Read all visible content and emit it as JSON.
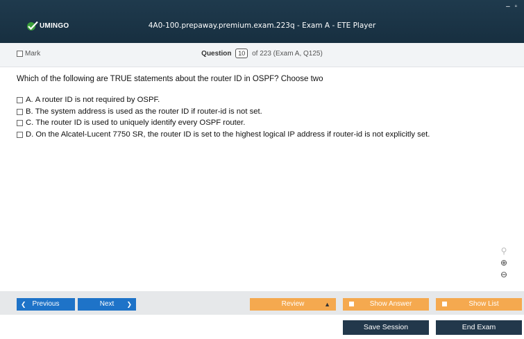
{
  "window": {
    "title": "4A0-100.prepaway.premium.exam.223q - Exam A - ETE Player",
    "controls": "– ▫",
    "logo_text": "UMINGO"
  },
  "question_bar": {
    "mark_label": "Mark",
    "question_label": "Question",
    "question_number": "10",
    "counter_rest": "of 223 (Exam A, Q125)"
  },
  "question": {
    "text": "Which of the following are TRUE statements about the router ID in OSPF? Choose two",
    "options": [
      {
        "letter": "A.",
        "text": "A router ID is not required by OSPF."
      },
      {
        "letter": "B.",
        "text": "The system address is used as the router ID if router-id is not set."
      },
      {
        "letter": "C.",
        "text": "The router ID is used to uniquely identify every OSPF router."
      },
      {
        "letter": "D.",
        "text": "On the Alcatel-Lucent 7750 SR, the router ID is set to the highest logical IP address if router-id is not explicitly set."
      }
    ]
  },
  "zoom": {
    "search_icon": "search-icon",
    "zoom_in_icon": "zoom-in-icon",
    "zoom_out_icon": "zoom-out-icon"
  },
  "buttons": {
    "previous": "Previous",
    "next": "Next",
    "review": "Review",
    "show_answer": "Show Answer",
    "show_list": "Show List",
    "save_session": "Save Session",
    "end_exam": "End Exam"
  },
  "colors": {
    "titlebar": "#1f3a4d",
    "nav_blue": "#1e73c8",
    "accent_orange": "#f5a94f",
    "dark_button": "#22384b"
  }
}
